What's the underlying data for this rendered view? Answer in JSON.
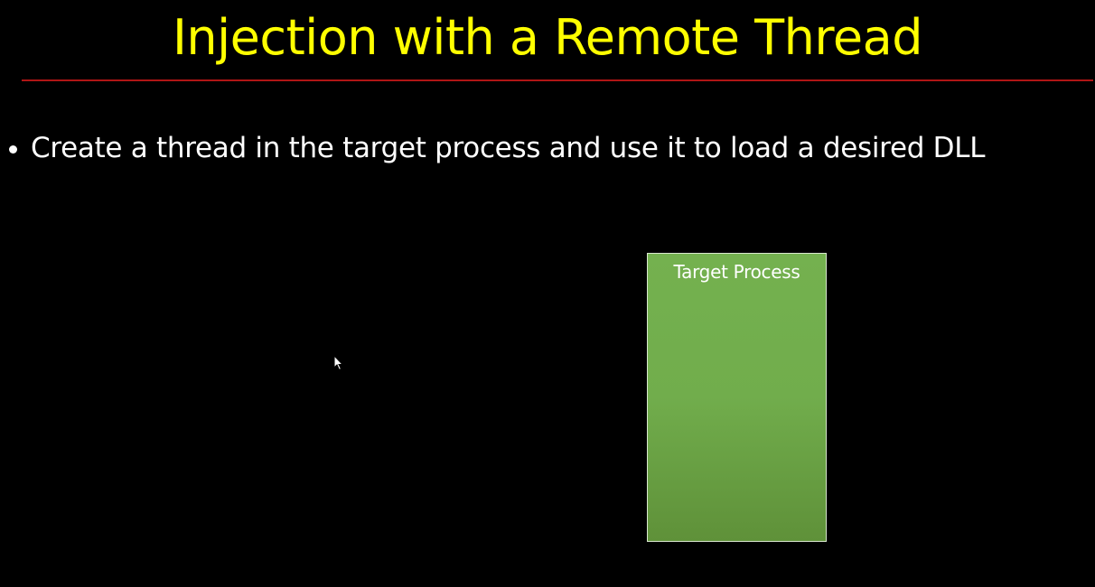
{
  "slide": {
    "title": "Injection with a Remote Thread",
    "bullets": [
      "Create a thread in the target process and use it to load a desired DLL"
    ]
  },
  "diagram": {
    "process_box_label": "Target Process"
  },
  "colors": {
    "background": "#000000",
    "title": "#ffff00",
    "title_rule": "#b01515",
    "body_text": "#ffffff",
    "process_box_fill": "#70ad47",
    "process_box_border": "#d9e8cf"
  },
  "icons": {
    "cursor": "mouse-pointer-icon"
  }
}
